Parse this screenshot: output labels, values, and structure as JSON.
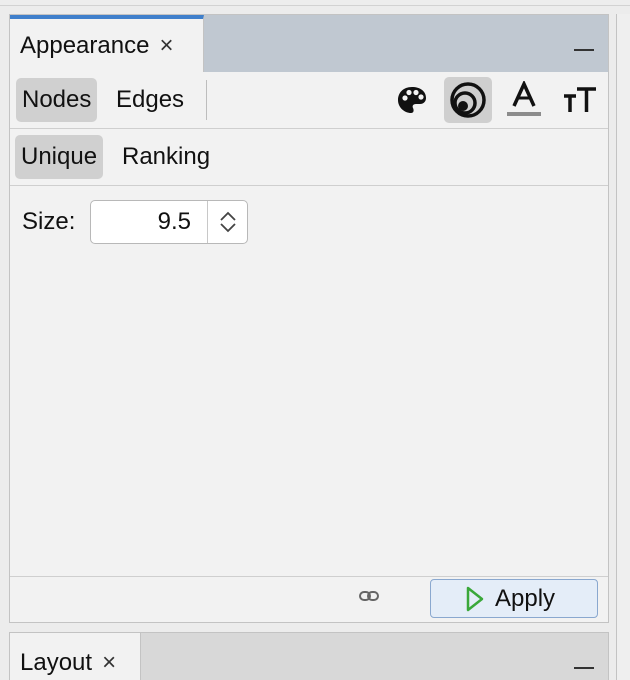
{
  "appearance": {
    "title": "Appearance",
    "close_glyph": "×",
    "modes": [
      {
        "label": "Nodes",
        "selected": true
      },
      {
        "label": "Edges",
        "selected": false
      }
    ],
    "attributes": [
      {
        "icon": "palette-icon",
        "name": "color"
      },
      {
        "icon": "size-icon",
        "name": "size",
        "selected": true
      },
      {
        "icon": "label-color-icon",
        "name": "label-color"
      },
      {
        "icon": "label-size-icon",
        "name": "label-size"
      }
    ],
    "types": [
      {
        "label": "Unique",
        "selected": true
      },
      {
        "label": "Ranking",
        "selected": false
      }
    ],
    "size": {
      "label": "Size:",
      "value": "9.5"
    },
    "apply_label": "Apply"
  },
  "layout": {
    "title": "Layout",
    "close_glyph": "×"
  },
  "colors": {
    "accent": "#3f7fcb",
    "tabbar": "#c0c8d1",
    "apply_green": "#3aa83a"
  }
}
